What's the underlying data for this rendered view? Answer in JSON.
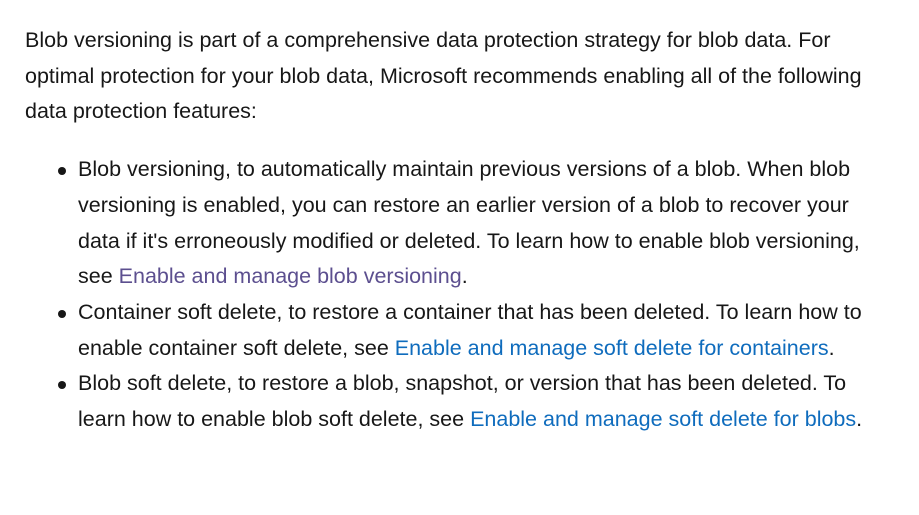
{
  "intro": "Blob versioning is part of a comprehensive data protection strategy for blob data. For optimal protection for your blob data, Microsoft recommends enabling all of the following data protection features:",
  "items": [
    {
      "text": "Blob versioning, to automatically maintain previous versions of a blob. When blob versioning is enabled, you can restore an earlier version of a blob to recover your data if it's erroneously modified or deleted. To learn how to enable blob versioning, see ",
      "link": "Enable and manage blob versioning",
      "after": "."
    },
    {
      "text": "Container soft delete, to restore a container that has been deleted. To learn how to enable container soft delete, see ",
      "link": "Enable and manage soft delete for containers",
      "after": "."
    },
    {
      "text": "Blob soft delete, to restore a blob, snapshot, or version that has been deleted. To learn how to enable blob soft delete, see ",
      "link": "Enable and manage soft delete for blobs",
      "after": "."
    }
  ],
  "colors": {
    "text": "#171717",
    "link": "#0f6cbd",
    "visited_link": "#5c4f8f",
    "background": "#ffffff"
  }
}
